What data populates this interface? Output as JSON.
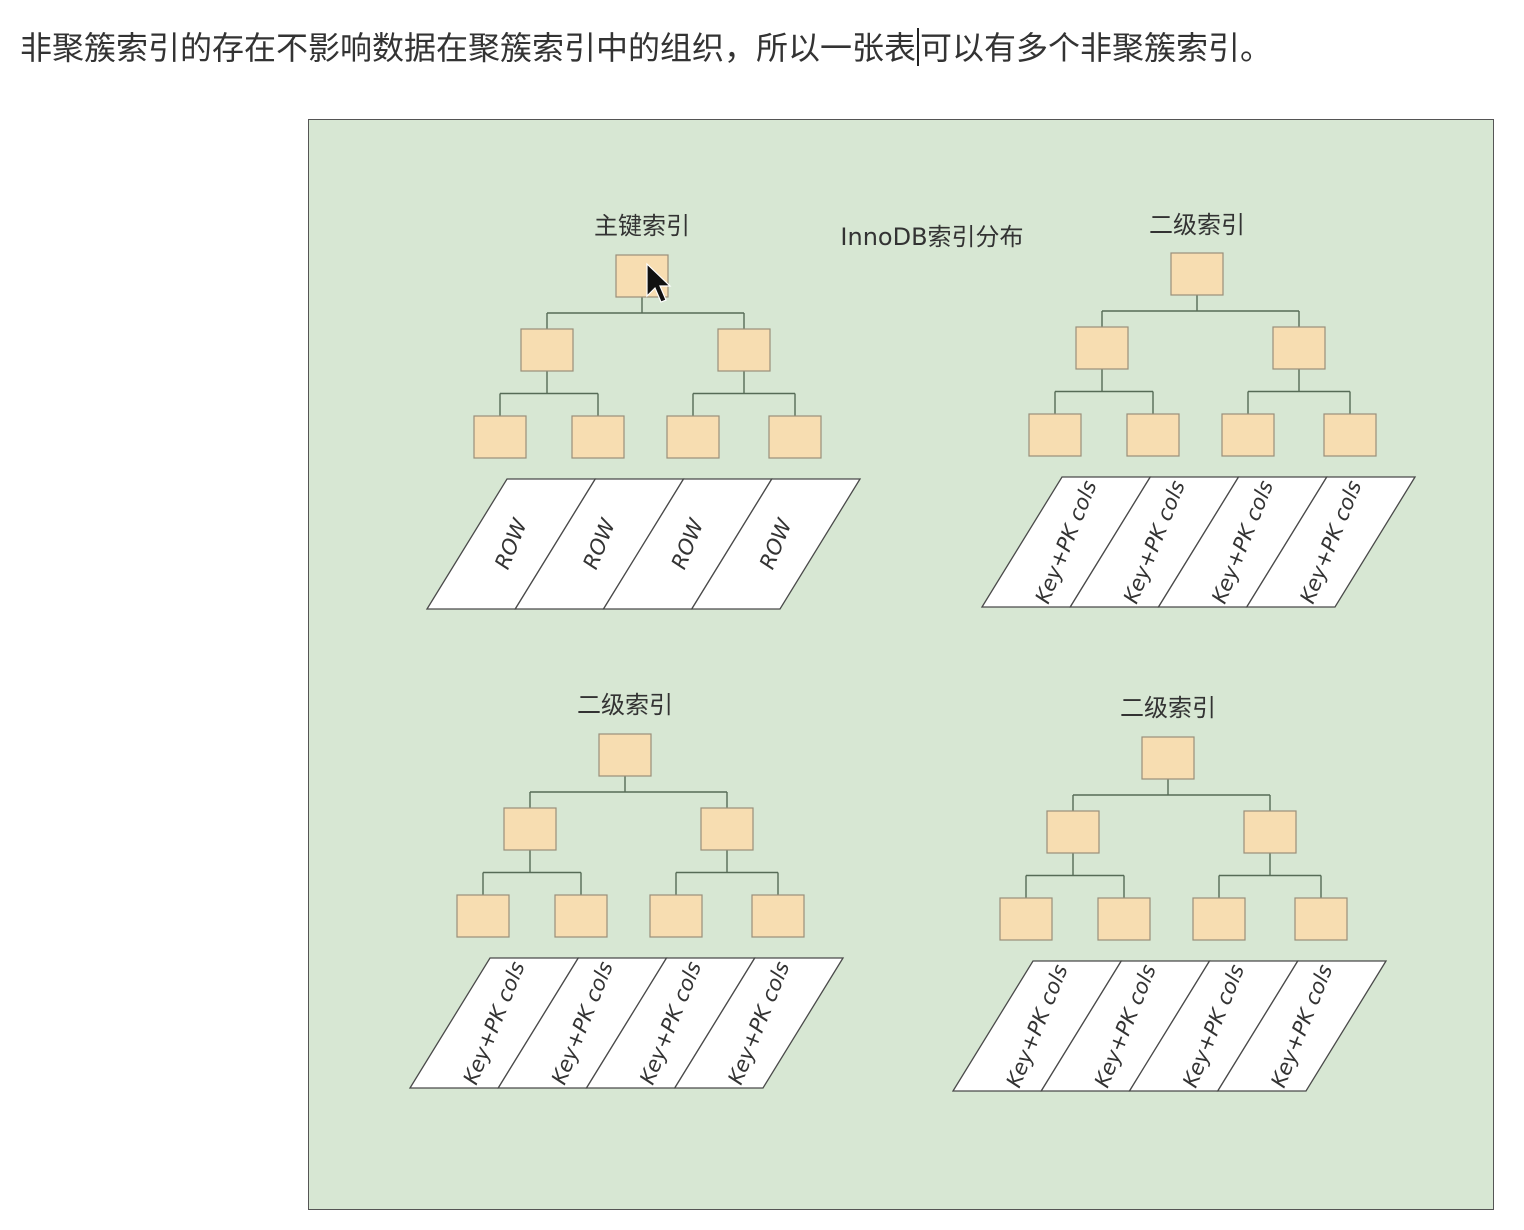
{
  "intro": {
    "before_cursor": "非聚簇索引的存在不影响数据在聚簇索引中的组织，所以一张表",
    "after_cursor": "可以有多个非聚簇索引。"
  },
  "diagram": {
    "title": "InnoDB索引分布",
    "trees": [
      {
        "title": "主键索引",
        "cells": [
          "ROW",
          "ROW",
          "ROW",
          "ROW"
        ]
      },
      {
        "title": "二级索引",
        "cells": [
          "Key+PK cols",
          "Key+PK cols",
          "Key+PK cols",
          "Key+PK cols"
        ]
      },
      {
        "title": "二级索引",
        "cells": [
          "Key+PK cols",
          "Key+PK cols",
          "Key+PK cols",
          "Key+PK cols"
        ]
      },
      {
        "title": "二级索引",
        "cells": [
          "Key+PK cols",
          "Key+PK cols",
          "Key+PK cols",
          "Key+PK cols"
        ]
      }
    ],
    "colors": {
      "background": "#d7e7d3",
      "node_fill": "#f7ddb1",
      "edge": "#566b56"
    }
  }
}
